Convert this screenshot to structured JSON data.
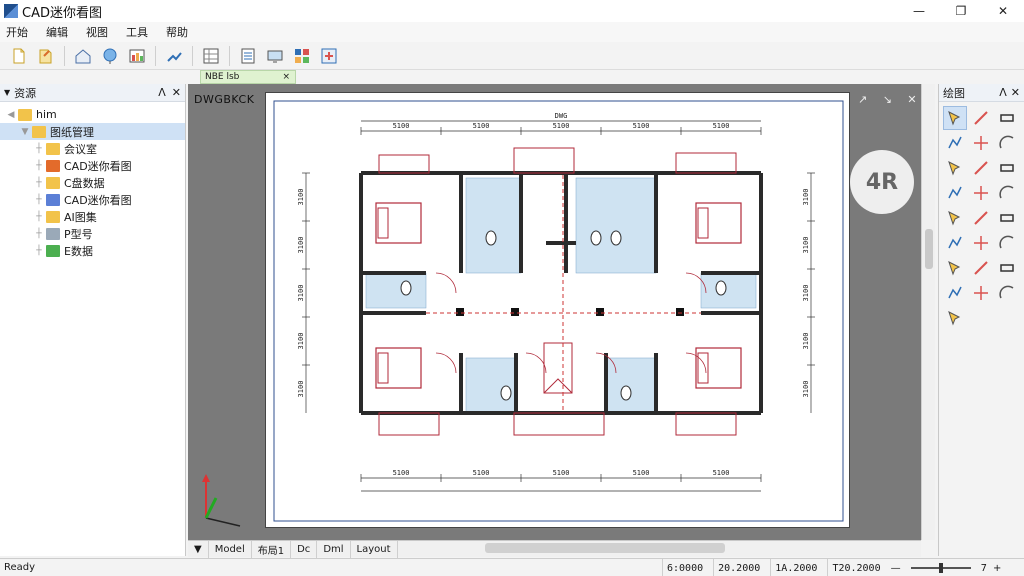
{
  "app": {
    "title": "CAD迷你看图"
  },
  "window_controls": {
    "minimize": "—",
    "maximize": "❐",
    "close": "✕"
  },
  "menu": [
    "开始",
    "编辑",
    "视图",
    "工具",
    "帮助"
  ],
  "toolbar_icons": [
    "new-file-icon",
    "open-file-icon",
    "home-icon",
    "globe-icon",
    "layers-icon",
    "measure-icon",
    "grid-icon",
    "print-icon",
    "monitor-icon",
    "palette-icon",
    "settings-icon"
  ],
  "doc_tab": {
    "label": "NBE lsb",
    "close": "×"
  },
  "left_panel": {
    "title": "资源",
    "pin": "ᐱ",
    "close": "✕",
    "tree": [
      {
        "label": "him",
        "level": 0,
        "selected": false
      },
      {
        "label": "图纸管理",
        "level": 1,
        "selected": true
      },
      {
        "label": "会议室",
        "level": 2,
        "selected": false
      },
      {
        "label": "CAD迷你看图",
        "level": 2,
        "selected": false
      },
      {
        "label": "C盘数据",
        "level": 2,
        "selected": false
      },
      {
        "label": "CAD迷你看图",
        "level": 2,
        "selected": false
      },
      {
        "label": "AI图集",
        "level": 2,
        "selected": false
      },
      {
        "label": "P型号",
        "level": 2,
        "selected": false
      },
      {
        "label": "E数据",
        "level": 2,
        "selected": false
      }
    ]
  },
  "drawing": {
    "title": "DWGBKCK",
    "view_cube_label": "4R",
    "view_ctrls": "↗ ↘ ✕",
    "dim_top": [
      "5100",
      "5100",
      "5100",
      "5100",
      "5100"
    ],
    "dim_top_total": "DWG",
    "dim_bottom": [
      "5100",
      "5100",
      "5100",
      "5100",
      "5100"
    ],
    "dim_left": [
      "3100",
      "3100",
      "3100",
      "3100",
      "3100"
    ],
    "dim_right": [
      "3100",
      "3100",
      "3100",
      "3100",
      "3100"
    ],
    "axis_labels": [
      "Y",
      "X"
    ]
  },
  "right_panel": {
    "title": "绘图",
    "icons": [
      "select-icon",
      "line-icon",
      "erase-icon",
      "polyline-icon",
      "move-icon",
      "arc-icon",
      "rotate-icon",
      "mirror-icon",
      "offset-icon",
      "extend-icon",
      "copy-icon",
      "array-icon",
      "trim-icon",
      "text-icon",
      "rect-icon",
      "zoom-icon",
      "hatch-icon",
      "circle-icon",
      "fillet-icon",
      "dimension-icon",
      "block-icon",
      "scale-icon",
      "measure-icon",
      "point-icon",
      "export-icon"
    ]
  },
  "bottom_tabs": [
    "Model",
    "布局1",
    "Dc",
    "Dml",
    "Layout"
  ],
  "status": {
    "ready": "Ready",
    "coords": [
      "6:0000",
      "20.2000",
      "1A.2000",
      "T20.2000"
    ],
    "zoom_min": "—",
    "zoom_max": "+",
    "zoom_level": "7"
  },
  "colors": {
    "accent": "#1f6fc7",
    "wall": "#2a2a2a",
    "room_red": "#b02a3a",
    "tile_blue": "#cfe3f2",
    "selection": "#cfe1f5"
  }
}
